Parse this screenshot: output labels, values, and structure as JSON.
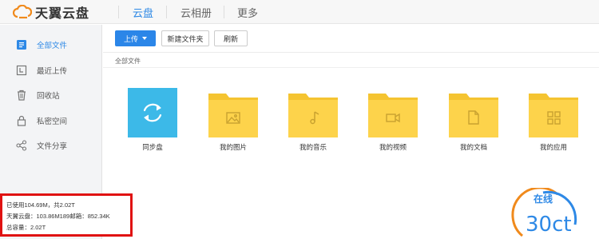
{
  "header": {
    "logo_text": "天翼云盘",
    "nav": [
      {
        "label": "云盘",
        "active": true
      },
      {
        "label": "云相册",
        "active": false
      },
      {
        "label": "更多",
        "active": false
      }
    ]
  },
  "sidebar": {
    "items": [
      {
        "label": "全部文件",
        "icon": "all-files-icon",
        "active": true
      },
      {
        "label": "最近上传",
        "icon": "recent-upload-icon",
        "active": false
      },
      {
        "label": "回收站",
        "icon": "trash-icon",
        "active": false
      },
      {
        "label": "私密空间",
        "icon": "lock-icon",
        "active": false
      },
      {
        "label": "文件分享",
        "icon": "share-icon",
        "active": false
      }
    ]
  },
  "toolbar": {
    "upload_label": "上传",
    "new_folder_label": "新建文件夹",
    "refresh_label": "刷新"
  },
  "breadcrumb": "全部文件",
  "files": [
    {
      "name": "同步盘",
      "type": "sync",
      "icon": "sync-icon"
    },
    {
      "name": "我的图片",
      "type": "folder",
      "icon": "image-icon"
    },
    {
      "name": "我的音乐",
      "type": "folder",
      "icon": "music-icon"
    },
    {
      "name": "我的视频",
      "type": "folder",
      "icon": "video-icon"
    },
    {
      "name": "我的文档",
      "type": "folder",
      "icon": "document-icon"
    },
    {
      "name": "我的应用",
      "type": "folder",
      "icon": "apps-icon"
    }
  ],
  "usage": {
    "used_line": "已使用104.69M，共2.02T",
    "detail_line": "天翼云盘：103.86M189邮箱：852.34K",
    "total_line": "总容量：2.02T"
  },
  "watermark": {
    "text_top": "在线",
    "text_bottom": "30ct"
  },
  "colors": {
    "accent": "#2e89e6",
    "folder": "#fdd34b",
    "folder_tab": "#f5c431",
    "sync": "#3cb9e8",
    "usage_border": "#e01212"
  }
}
